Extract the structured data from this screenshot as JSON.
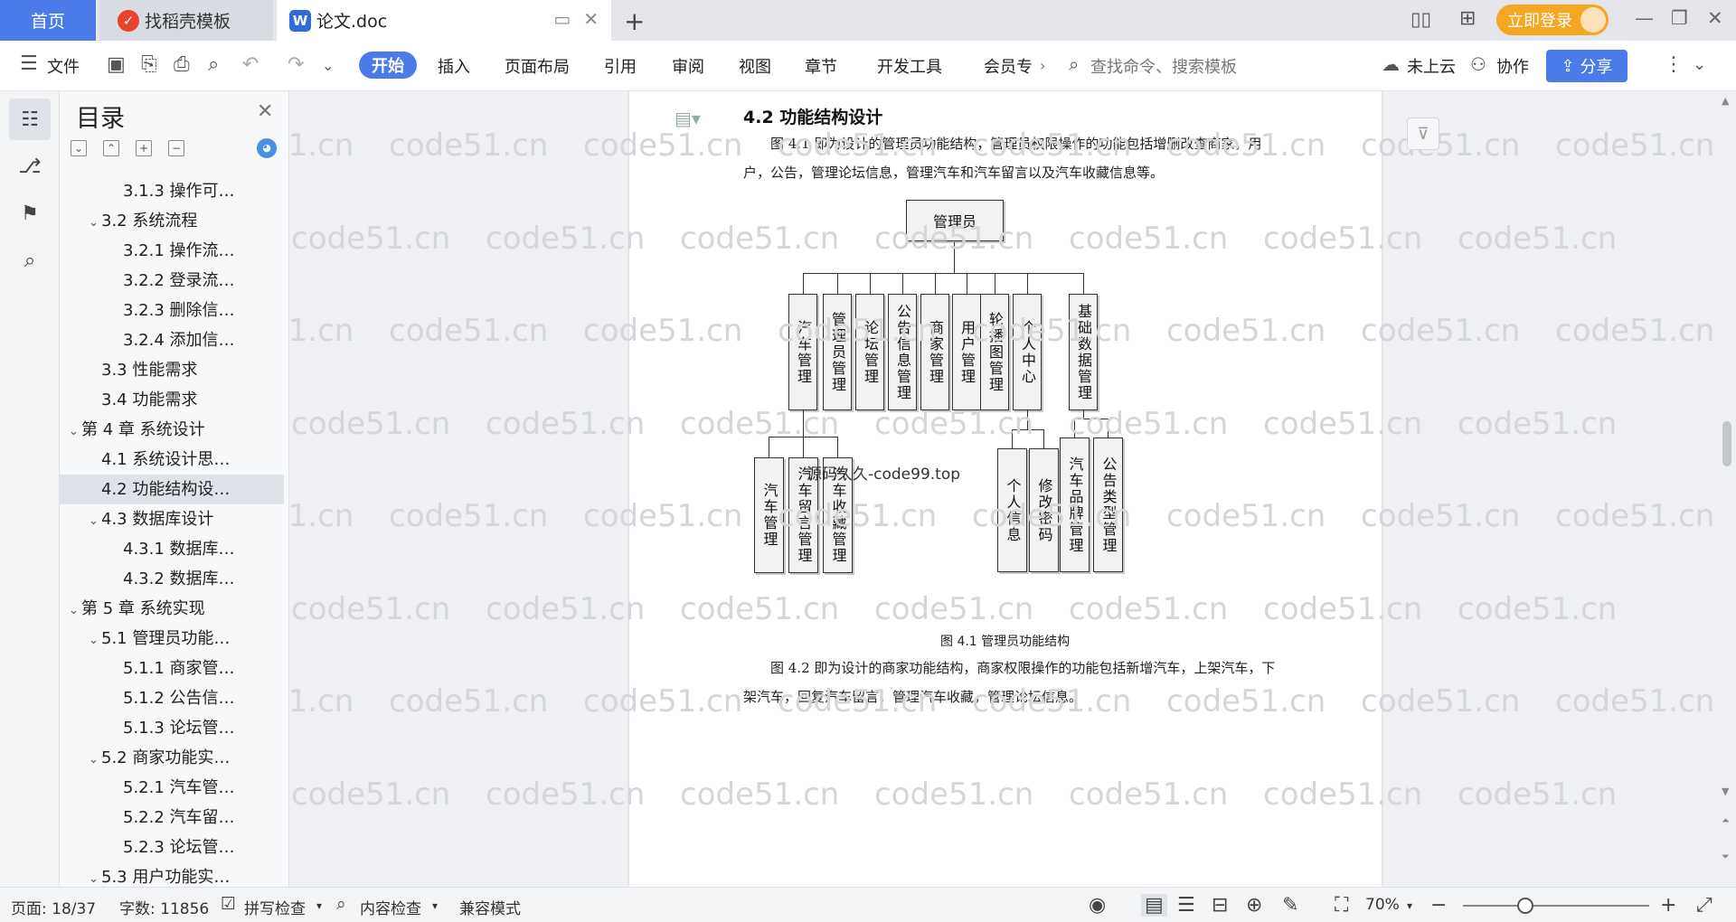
{
  "tabs": {
    "home": "首页",
    "templates": "找稻壳模板",
    "document": "论文.doc"
  },
  "header": {
    "login": "立即登录"
  },
  "toolbar": {
    "file": "文件",
    "tabs": [
      "开始",
      "插入",
      "页面布局",
      "引用",
      "审阅",
      "视图",
      "章节",
      "开发工具",
      "会员专"
    ],
    "search_placeholder": "查找命令、搜索模板",
    "cloud": "未上云",
    "collab": "协作",
    "share": "分享"
  },
  "toc": {
    "title": "目录",
    "items": [
      {
        "label": "3.1.3  操作可…",
        "level": 3,
        "collapsible": false
      },
      {
        "label": "3.2  系统流程",
        "level": 2,
        "collapsible": true
      },
      {
        "label": "3.2.1  操作流…",
        "level": 3,
        "collapsible": false
      },
      {
        "label": "3.2.2  登录流…",
        "level": 3,
        "collapsible": false
      },
      {
        "label": "3.2.3  删除信…",
        "level": 3,
        "collapsible": false
      },
      {
        "label": "3.2.4  添加信…",
        "level": 3,
        "collapsible": false
      },
      {
        "label": "3.3  性能需求",
        "level": 2,
        "collapsible": false
      },
      {
        "label": "3.4  功能需求",
        "level": 2,
        "collapsible": false
      },
      {
        "label": "第 4 章  系统设计",
        "level": 1,
        "collapsible": true
      },
      {
        "label": "4.1  系统设计思…",
        "level": 2,
        "collapsible": false
      },
      {
        "label": "4.2  功能结构设…",
        "level": 2,
        "collapsible": false,
        "selected": true
      },
      {
        "label": "4.3  数据库设计",
        "level": 2,
        "collapsible": true
      },
      {
        "label": "4.3.1  数据库…",
        "level": 3,
        "collapsible": false
      },
      {
        "label": "4.3.2  数据库…",
        "level": 3,
        "collapsible": false
      },
      {
        "label": "第 5 章  系统实现",
        "level": 1,
        "collapsible": true
      },
      {
        "label": "5.1  管理员功能…",
        "level": 2,
        "collapsible": true
      },
      {
        "label": "5.1.1  商家管…",
        "level": 3,
        "collapsible": false
      },
      {
        "label": "5.1.2  公告信…",
        "level": 3,
        "collapsible": false
      },
      {
        "label": "5.1.3  论坛管…",
        "level": 3,
        "collapsible": false
      },
      {
        "label": "5.2  商家功能实…",
        "level": 2,
        "collapsible": true
      },
      {
        "label": "5.2.1  汽车管…",
        "level": 3,
        "collapsible": false
      },
      {
        "label": "5.2.2  汽车留…",
        "level": 3,
        "collapsible": false
      },
      {
        "label": "5.2.3  论坛管…",
        "level": 3,
        "collapsible": false
      },
      {
        "label": "5.3  用户功能实…",
        "level": 2,
        "collapsible": true
      }
    ]
  },
  "document": {
    "heading": "4.2  功能结构设计",
    "para1": "图 4.1 即为设计的管理员功能结构，管理员权限操作的功能包括增删改查商家，用户，公告，管理论坛信息，管理汽车和汽车留言以及汽车收藏信息等。",
    "figure": {
      "root": "管理员",
      "level1": [
        "汽车管理",
        "管理员管理",
        "论坛管理",
        "公告信息管理",
        "商家管理",
        "用户管理",
        "轮播图管理",
        "个人中心",
        "基础数据管理"
      ],
      "car_children": [
        "汽车管理",
        "汽车留言管理",
        "汽车收藏管理"
      ],
      "center_children": [
        "个人信息",
        "修改密码"
      ],
      "basic_children": [
        "汽车品牌管理",
        "公告类型管理"
      ],
      "caption": "图 4.1  管理员功能结构"
    },
    "para2": "图 4.2 即为设计的商家功能结构，商家权限操作的功能包括新增汽车，上架汽车，下架汽车，回复汽车留言，管理汽车收藏，管理论坛信息。",
    "inline_watermark": "源码久久-code99.top",
    "watermark_text": "code51.cn"
  },
  "status": {
    "page": "页面: 18/37",
    "words": "字数: 11856",
    "spellcheck": "拼写检查",
    "content_check": "内容检查",
    "compat": "兼容模式",
    "zoom": "70%"
  }
}
